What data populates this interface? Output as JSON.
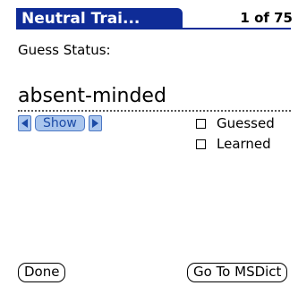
{
  "header": {
    "title": "Neutral Trai...",
    "counter": "1 of 75"
  },
  "status": {
    "label": "Guess Status:"
  },
  "word": {
    "text": "absent-minded"
  },
  "nav": {
    "show_label": "Show",
    "prev_icon": "left-triangle-icon",
    "next_icon": "right-triangle-icon"
  },
  "checks": [
    {
      "label": "Guessed",
      "checked": false
    },
    {
      "label": "Learned",
      "checked": false
    }
  ],
  "footer": {
    "done_label": "Done",
    "msdict_label": "Go To MSDict"
  },
  "colors": {
    "title_bg": "#0f2c97",
    "button_fill": "#aac6ee",
    "button_border": "#4c78c4"
  }
}
